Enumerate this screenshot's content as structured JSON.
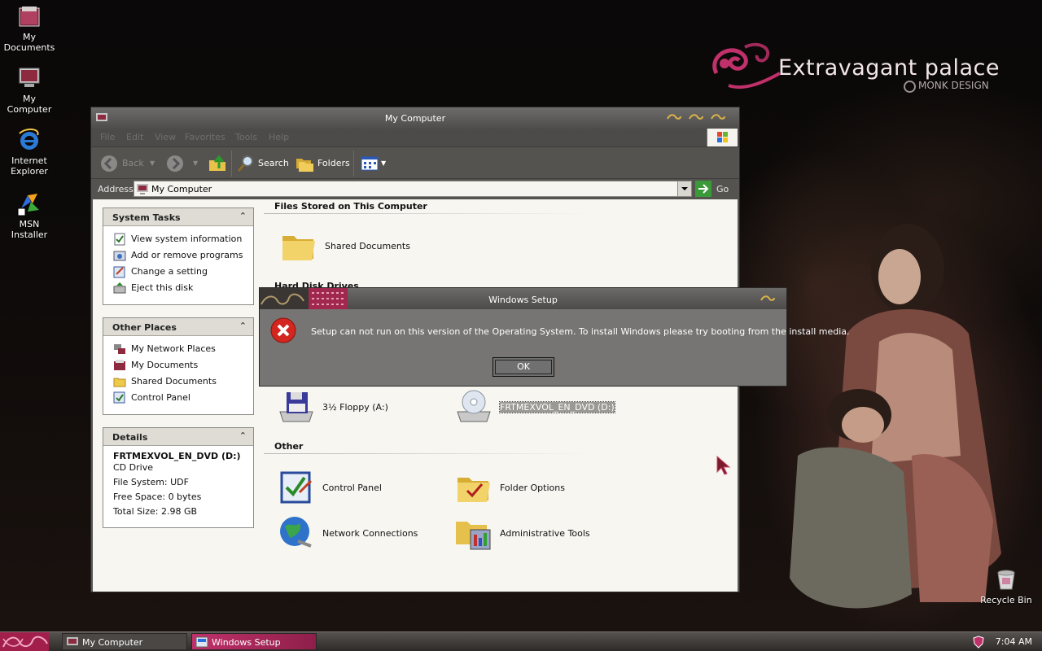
{
  "brand": {
    "title": "Extravagant palace",
    "subtitle": "MONK DESIGN"
  },
  "desktop_icons": [
    {
      "label": "My Documents",
      "icon": "my-documents-icon"
    },
    {
      "label": "My Computer",
      "icon": "my-computer-icon"
    },
    {
      "label": "Internet Explorer",
      "icon": "internet-explorer-icon"
    },
    {
      "label": "MSN Installer",
      "icon": "msn-installer-icon"
    }
  ],
  "recycle_bin": {
    "label": "Recycle Bin",
    "icon": "recycle-bin-icon"
  },
  "explorer": {
    "title": "My Computer",
    "menu": [
      "File",
      "Edit",
      "View",
      "Favorites",
      "Tools",
      "Help"
    ],
    "toolbar": {
      "back": "Back",
      "search": "Search",
      "folders": "Folders"
    },
    "address": {
      "label": "Address",
      "value": "My Computer",
      "go": "Go"
    },
    "system_tasks": {
      "title": "System Tasks",
      "items": [
        "View system information",
        "Add or remove programs",
        "Change a setting",
        "Eject this disk"
      ]
    },
    "other_places": {
      "title": "Other Places",
      "items": [
        "My Network Places",
        "My Documents",
        "Shared Documents",
        "Control Panel"
      ]
    },
    "details": {
      "title": "Details",
      "name": "FRTMEXVOL_EN_DVD (D:)",
      "type": "CD Drive",
      "file_system": "File System: UDF",
      "free_space": "Free Space: 0 bytes",
      "total_size": "Total Size: 2.98 GB"
    },
    "sections": {
      "stored": "Files Stored on This Computer",
      "hard_disks": "Hard Disk Drives",
      "other": "Other"
    },
    "items": {
      "shared_documents": "Shared Documents",
      "floppy": "3½ Floppy (A:)",
      "dvd": "FRTMEXVOL_EN_DVD (D:)",
      "control_panel": "Control Panel",
      "folder_options": "Folder Options",
      "network_connections": "Network Connections",
      "admin_tools": "Administrative Tools"
    }
  },
  "dialog": {
    "title": "Windows Setup",
    "message": "Setup can not run on this version of the Operating System. To install Windows please try booting from the install media.",
    "ok": "OK"
  },
  "taskbar": {
    "buttons": [
      "My Computer",
      "Windows Setup"
    ],
    "clock": "7:04 AM"
  },
  "colors": {
    "wallpaper": "#050404",
    "window_frame": "#5a5957",
    "pane_header": "#dedcd4",
    "dialog_bg": "#767573",
    "brand_pink": "#c0306a"
  }
}
